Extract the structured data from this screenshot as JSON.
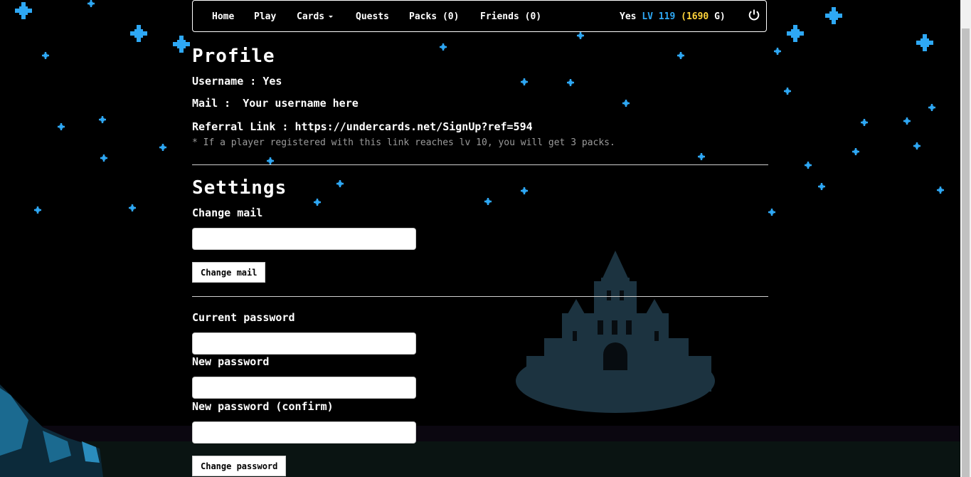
{
  "nav": {
    "items": [
      "Home",
      "Play",
      "Cards",
      "Quests",
      "Packs (0)",
      "Friends (0)"
    ],
    "user": {
      "name": "Yes",
      "lv_label": "LV 119",
      "gold_open": "(",
      "gold_amount": "1690",
      "gold_close": " G)"
    },
    "logout_icon": "power-icon"
  },
  "profile": {
    "heading": "Profile",
    "username": "Username : Yes",
    "mail_label": "Mail : ",
    "mail_value": "Your username here",
    "referral": "Referral Link : https://undercards.net/SignUp?ref=594",
    "referral_note": "* If a player registered with this link reaches lv 10, you will get 3 packs."
  },
  "settings": {
    "heading": "Settings",
    "change_mail_label": "Change mail",
    "change_mail_button": "Change mail",
    "current_password_label": "Current password",
    "new_password_label": "New password",
    "confirm_password_label": "New password (confirm)",
    "change_password_button": "Change password"
  },
  "colors": {
    "lv": "#2ea8f5",
    "gold": "#ffd43b",
    "star": "#2ea8f5",
    "castle": "#1c3340"
  }
}
